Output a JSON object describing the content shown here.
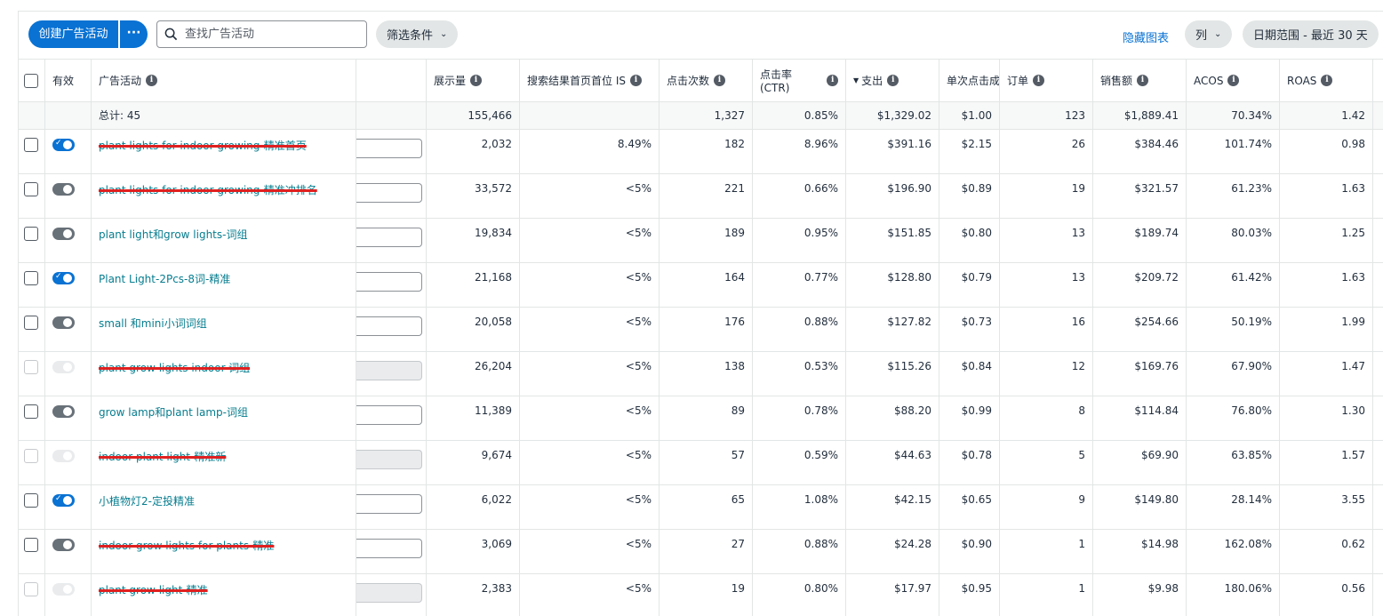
{
  "toolbar": {
    "create_label": "创建广告活动",
    "more_label": "···",
    "search_placeholder": "查找广告活动",
    "filter_label": "筛选条件",
    "hide_chart_label": "隐藏图表",
    "columns_label": "列",
    "date_range_label": "日期范围 - 最近 30 天"
  },
  "columns": {
    "active": "有效",
    "campaign": "广告活动",
    "impressions": "展示量",
    "top_of_search_is": "搜索结果首页首位 IS",
    "clicks": "点击次数",
    "ctr": "点击率 (CTR)",
    "spend": "支出",
    "cpc": "单次点击成",
    "orders": "订单",
    "sales": "销售额",
    "acos": "ACOS",
    "roas": "ROAS"
  },
  "totals": {
    "label": "总计: 45",
    "impressions": "155,466",
    "top_of_search_is": "",
    "clicks": "1,327",
    "ctr": "0.85%",
    "spend": "$1,329.02",
    "cpc": "$1.00",
    "orders": "123",
    "sales": "$1,889.41",
    "acos": "70.34%",
    "roas": "1.42"
  },
  "rows": [
    {
      "status": "on",
      "name": "plant lights for indoor growing-精准首页",
      "struck": true,
      "impressions": "2,032",
      "tos": "8.49%",
      "clicks": "182",
      "ctr": "8.96%",
      "spend": "$391.16",
      "cpc": "$2.15",
      "orders": "26",
      "sales": "$384.46",
      "acos": "101.74%",
      "roas": "0.98"
    },
    {
      "status": "off",
      "name": "plant lights for indoor growing-精准冲排名",
      "struck": true,
      "impressions": "33,572",
      "tos": "<5%",
      "clicks": "221",
      "ctr": "0.66%",
      "spend": "$196.90",
      "cpc": "$0.89",
      "orders": "19",
      "sales": "$321.57",
      "acos": "61.23%",
      "roas": "1.63"
    },
    {
      "status": "off",
      "name": "plant light和grow lights-词组",
      "struck": false,
      "impressions": "19,834",
      "tos": "<5%",
      "clicks": "189",
      "ctr": "0.95%",
      "spend": "$151.85",
      "cpc": "$0.80",
      "orders": "13",
      "sales": "$189.74",
      "acos": "80.03%",
      "roas": "1.25"
    },
    {
      "status": "on",
      "name": "Plant Light-2Pcs-8词-精准",
      "struck": false,
      "impressions": "21,168",
      "tos": "<5%",
      "clicks": "164",
      "ctr": "0.77%",
      "spend": "$128.80",
      "cpc": "$0.79",
      "orders": "13",
      "sales": "$209.72",
      "acos": "61.42%",
      "roas": "1.63"
    },
    {
      "status": "off",
      "name": "small 和mini小词词组",
      "struck": false,
      "impressions": "20,058",
      "tos": "<5%",
      "clicks": "176",
      "ctr": "0.88%",
      "spend": "$127.82",
      "cpc": "$0.73",
      "orders": "16",
      "sales": "$254.66",
      "acos": "50.19%",
      "roas": "1.99"
    },
    {
      "status": "disabled",
      "name": "plant grow lights indoor-词组",
      "struck": true,
      "impressions": "26,204",
      "tos": "<5%",
      "clicks": "138",
      "ctr": "0.53%",
      "spend": "$115.26",
      "cpc": "$0.84",
      "orders": "12",
      "sales": "$169.76",
      "acos": "67.90%",
      "roas": "1.47"
    },
    {
      "status": "off",
      "name": "grow lamp和plant lamp-词组",
      "struck": false,
      "impressions": "11,389",
      "tos": "<5%",
      "clicks": "89",
      "ctr": "0.78%",
      "spend": "$88.20",
      "cpc": "$0.99",
      "orders": "8",
      "sales": "$114.84",
      "acos": "76.80%",
      "roas": "1.30"
    },
    {
      "status": "disabled",
      "name": "indoor plant light-精准新",
      "struck": true,
      "impressions": "9,674",
      "tos": "<5%",
      "clicks": "57",
      "ctr": "0.59%",
      "spend": "$44.63",
      "cpc": "$0.78",
      "orders": "5",
      "sales": "$69.90",
      "acos": "63.85%",
      "roas": "1.57"
    },
    {
      "status": "on",
      "name": "小植物灯2-定投精准",
      "struck": false,
      "impressions": "6,022",
      "tos": "<5%",
      "clicks": "65",
      "ctr": "1.08%",
      "spend": "$42.15",
      "cpc": "$0.65",
      "orders": "9",
      "sales": "$149.80",
      "acos": "28.14%",
      "roas": "3.55"
    },
    {
      "status": "off",
      "name": "indoor grow lights for plants-精准",
      "struck": true,
      "impressions": "3,069",
      "tos": "<5%",
      "clicks": "27",
      "ctr": "0.88%",
      "spend": "$24.28",
      "cpc": "$0.90",
      "orders": "1",
      "sales": "$14.98",
      "acos": "162.08%",
      "roas": "0.62"
    },
    {
      "status": "disabled",
      "name": "plant grow light-精准",
      "struck": true,
      "impressions": "2,383",
      "tos": "<5%",
      "clicks": "19",
      "ctr": "0.80%",
      "spend": "$17.97",
      "cpc": "$0.95",
      "orders": "1",
      "sales": "$9.98",
      "acos": "180.06%",
      "roas": "0.56"
    }
  ]
}
